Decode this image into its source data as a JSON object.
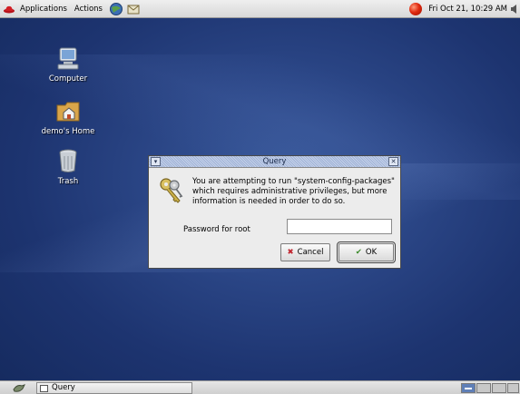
{
  "top_panel": {
    "menus": [
      "Applications",
      "Actions"
    ],
    "clock": "Fri Oct 21, 10:29 AM"
  },
  "desktop_icons": [
    {
      "label": "Computer",
      "icon": "computer-icon"
    },
    {
      "label": "demo's Home",
      "icon": "home-folder-icon"
    },
    {
      "label": "Trash",
      "icon": "trash-icon"
    }
  ],
  "dialog": {
    "title": "Query",
    "message": "You are attempting to run \"system-config-packages\" which requires administrative privileges, but more information is needed in order to do so.",
    "password_label": "Password for root",
    "password_value": "",
    "cancel_label": "Cancel",
    "ok_label": "OK",
    "icon": "keys-icon"
  },
  "bottom_panel": {
    "task_label": "Query"
  },
  "colors": {
    "desktop": "#2a4585",
    "panel": "#dcdcdc",
    "titlebar": "#9fb2d6"
  }
}
